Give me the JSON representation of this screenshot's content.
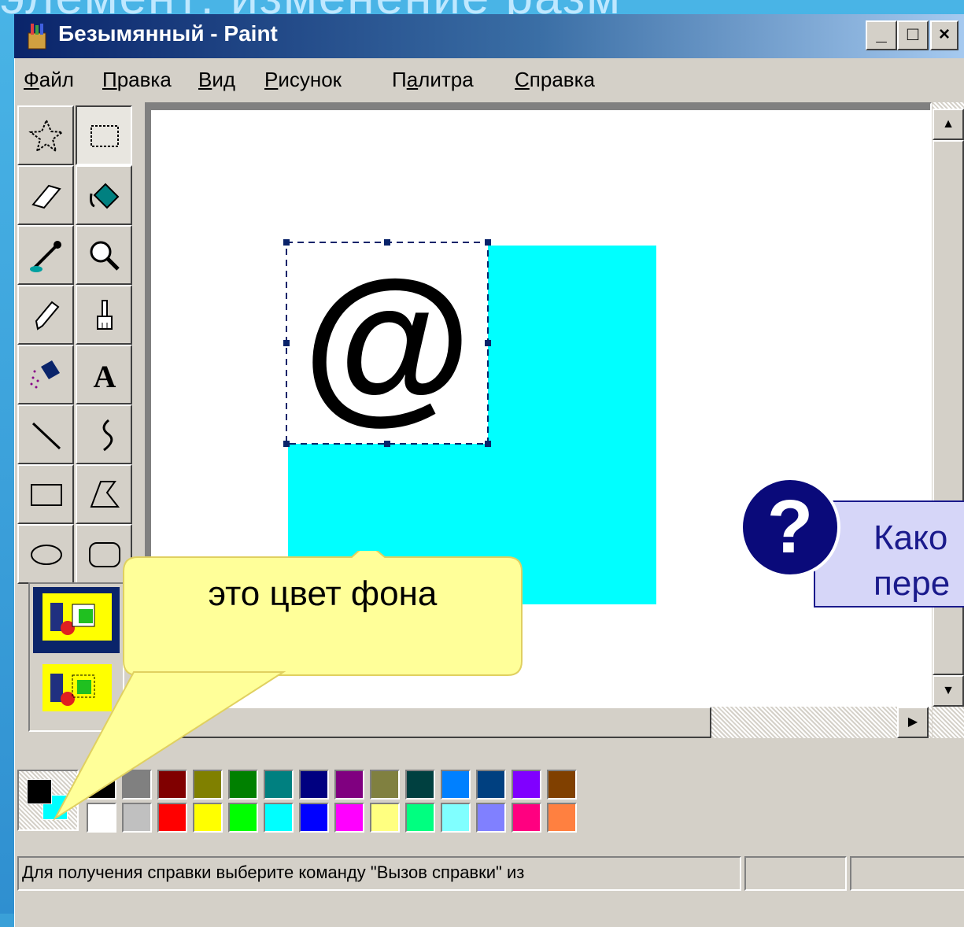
{
  "slide": {
    "heading": "элемент: изменение разм"
  },
  "window": {
    "title": "Безымянный - Paint",
    "buttons": {
      "minimize": "_",
      "maximize": "□",
      "close": "×"
    }
  },
  "menu": {
    "items": [
      {
        "label": "Файл",
        "underline": "Ф",
        "rest": "айл"
      },
      {
        "label": "Правка",
        "underline": "П",
        "rest": "равка"
      },
      {
        "label": "Вид",
        "underline": "В",
        "rest": "ид"
      },
      {
        "label": "Рисунок",
        "underline": "Р",
        "rest": "исунок"
      },
      {
        "label": "Палитра",
        "underline_pre": "П",
        "underline": "а",
        "rest": "литра"
      },
      {
        "label": "Справка",
        "underline": "С",
        "rest": "правка"
      }
    ]
  },
  "tools": [
    {
      "name": "free-select",
      "icon": "free-select-icon"
    },
    {
      "name": "rect-select",
      "icon": "rect-select-icon",
      "active": true
    },
    {
      "name": "eraser",
      "icon": "eraser-icon"
    },
    {
      "name": "fill",
      "icon": "fill-bucket-icon"
    },
    {
      "name": "pick-color",
      "icon": "eyedropper-icon"
    },
    {
      "name": "magnifier",
      "icon": "magnifier-icon"
    },
    {
      "name": "pencil",
      "icon": "pencil-icon"
    },
    {
      "name": "brush",
      "icon": "brush-icon"
    },
    {
      "name": "airbrush",
      "icon": "airbrush-icon"
    },
    {
      "name": "text",
      "icon": "text-tool-icon",
      "glyph": "A"
    },
    {
      "name": "line",
      "icon": "line-icon"
    },
    {
      "name": "curve",
      "icon": "curve-icon"
    },
    {
      "name": "rectangle",
      "icon": "rectangle-icon"
    },
    {
      "name": "polygon",
      "icon": "polygon-icon"
    },
    {
      "name": "ellipse",
      "icon": "ellipse-icon"
    },
    {
      "name": "rounded-rectangle",
      "icon": "rounded-rectangle-icon"
    }
  ],
  "canvas": {
    "selection_glyph": "@",
    "cyan_color": "#00ffff"
  },
  "palette": {
    "foreground": "#000000",
    "background": "#00ffff",
    "top_row": [
      "#000000",
      "#808080",
      "#800000",
      "#808000",
      "#008000",
      "#008080",
      "#000080",
      "#800080",
      "#808040",
      "#004040",
      "#0080ff",
      "#004080",
      "#8000ff",
      "#804000"
    ],
    "bottom_row": [
      "#ffffff",
      "#c0c0c0",
      "#ff0000",
      "#ffff00",
      "#00ff00",
      "#00ffff",
      "#0000ff",
      "#ff00ff",
      "#ffff80",
      "#00ff80",
      "#80ffff",
      "#8080ff",
      "#ff0080",
      "#ff8040"
    ]
  },
  "status": {
    "help_text": "Для получения справки выберите команду \"Вызов справки\" из"
  },
  "callouts": {
    "yellow": "это цвет фона",
    "question_mark": "?",
    "blue_line1": "Како",
    "blue_line2": "пере"
  }
}
